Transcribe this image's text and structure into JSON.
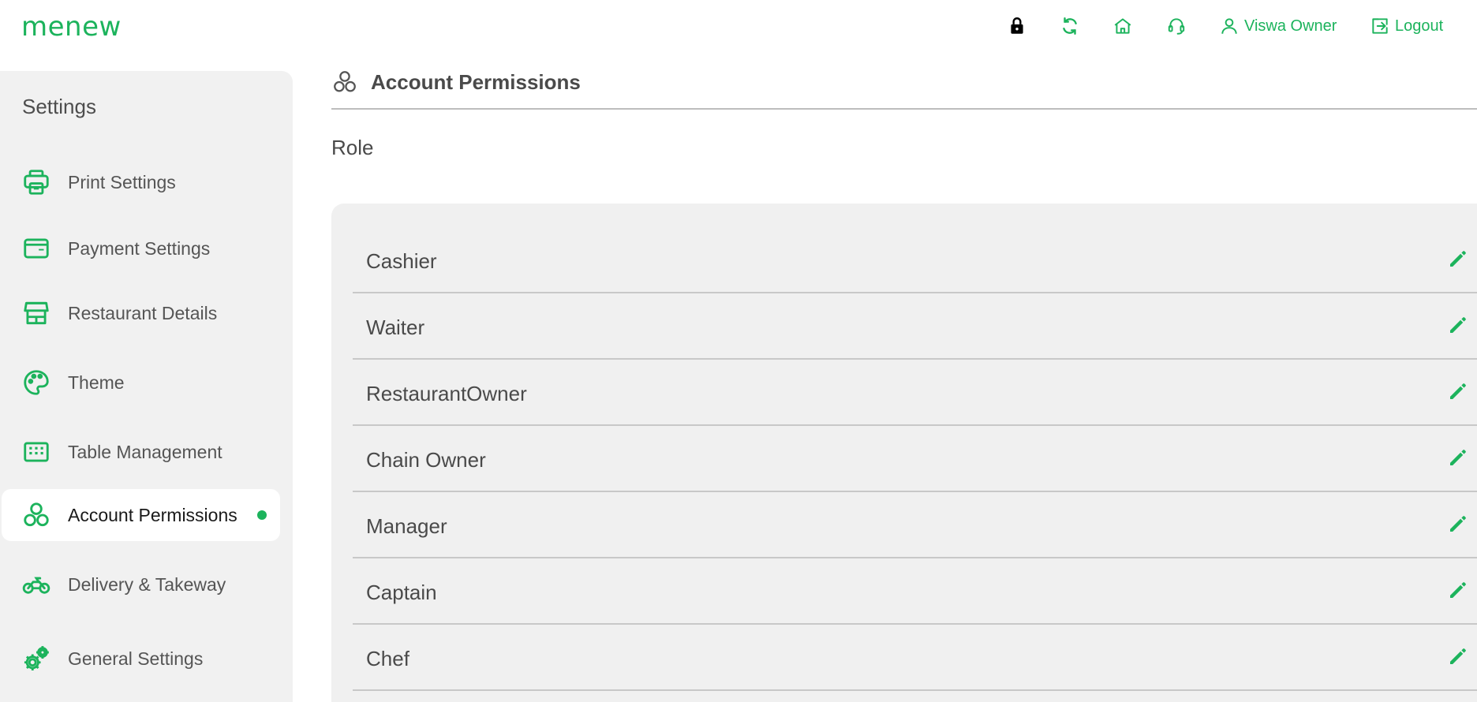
{
  "brand": {
    "logo_text": "menew",
    "accent_color": "#1cb35c"
  },
  "header": {
    "icons": [
      "lock-icon",
      "refresh-icon",
      "home-icon",
      "support-headset-icon"
    ],
    "user_name": "Viswa Owner",
    "logout_label": "Logout"
  },
  "sidebar": {
    "title": "Settings",
    "items": [
      {
        "label": "Print Settings",
        "icon": "printer-icon",
        "active": false
      },
      {
        "label": "Payment Settings",
        "icon": "card-icon",
        "active": false
      },
      {
        "label": "Restaurant Details",
        "icon": "store-icon",
        "active": false
      },
      {
        "label": "Theme",
        "icon": "palette-icon",
        "active": false
      },
      {
        "label": "Table Management",
        "icon": "table-grid-icon",
        "active": false
      },
      {
        "label": "Account Permissions",
        "icon": "permissions-icon",
        "active": true
      },
      {
        "label": "Delivery & Takeway",
        "icon": "motorbike-icon",
        "active": false
      },
      {
        "label": "General Settings",
        "icon": "gear-icon",
        "active": false
      }
    ]
  },
  "main": {
    "title": "Account Permissions",
    "section_label": "Role",
    "roles": [
      "Cashier",
      "Waiter",
      "RestaurantOwner",
      "Chain Owner",
      "Manager",
      "Captain",
      "Chef"
    ]
  }
}
